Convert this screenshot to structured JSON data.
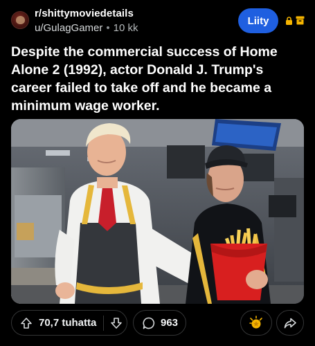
{
  "post": {
    "subreddit": "r/shittymoviedetails",
    "author": "u/GulagGamer",
    "separator": "•",
    "age": "10 kk",
    "join_label": "Liity",
    "title": "Despite the commercial success of Home Alone 2 (1992), actor Donald J. Trump's career failed to take off and he became a minimum wage worker."
  },
  "actions": {
    "upvotes": "70,7 tuhatta",
    "comments": "963"
  },
  "colors": {
    "background": "#000000",
    "join_button": "#1f5fe0",
    "lock_icon": "#f5b400",
    "award_icon": "#f5b400",
    "pill_border": "#343536"
  },
  "icons": [
    "subreddit-avatar",
    "lock-icon",
    "archive-icon",
    "upvote-icon",
    "downvote-icon",
    "comment-icon",
    "award-icon",
    "share-icon"
  ]
}
